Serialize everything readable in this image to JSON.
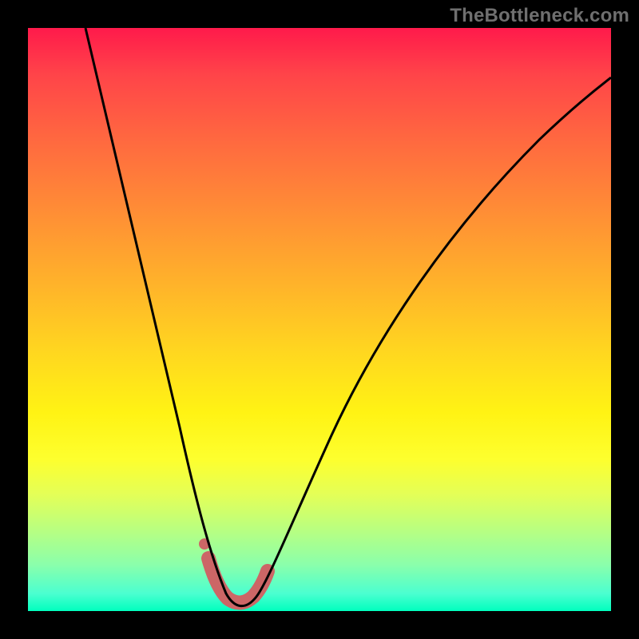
{
  "watermark": "TheBottleneck.com",
  "chart_data": {
    "type": "line",
    "title": "",
    "xlabel": "",
    "ylabel": "",
    "xlim": [
      0,
      100
    ],
    "ylim": [
      0,
      100
    ],
    "grid": false,
    "legend": false,
    "series": [
      {
        "name": "bottleneck-curve",
        "x": [
          10,
          15,
          20,
          24,
          27,
          30,
          32,
          33,
          34,
          35.5,
          37,
          38,
          40,
          43,
          48,
          55,
          63,
          72,
          82,
          92,
          100
        ],
        "y": [
          100,
          80,
          58,
          40,
          26,
          15,
          8,
          4.5,
          2.5,
          1.8,
          2.5,
          3.5,
          6,
          11,
          22,
          36,
          50,
          62,
          73,
          82,
          88
        ]
      }
    ],
    "highlight": {
      "name": "optimal-zone",
      "x": [
        31.5,
        39
      ],
      "y": [
        7,
        4
      ],
      "color": "#cc6666"
    },
    "background_gradient": {
      "top": "#ff1a4b",
      "mid": "#ffd81f",
      "bottom": "#00ffbe"
    }
  }
}
